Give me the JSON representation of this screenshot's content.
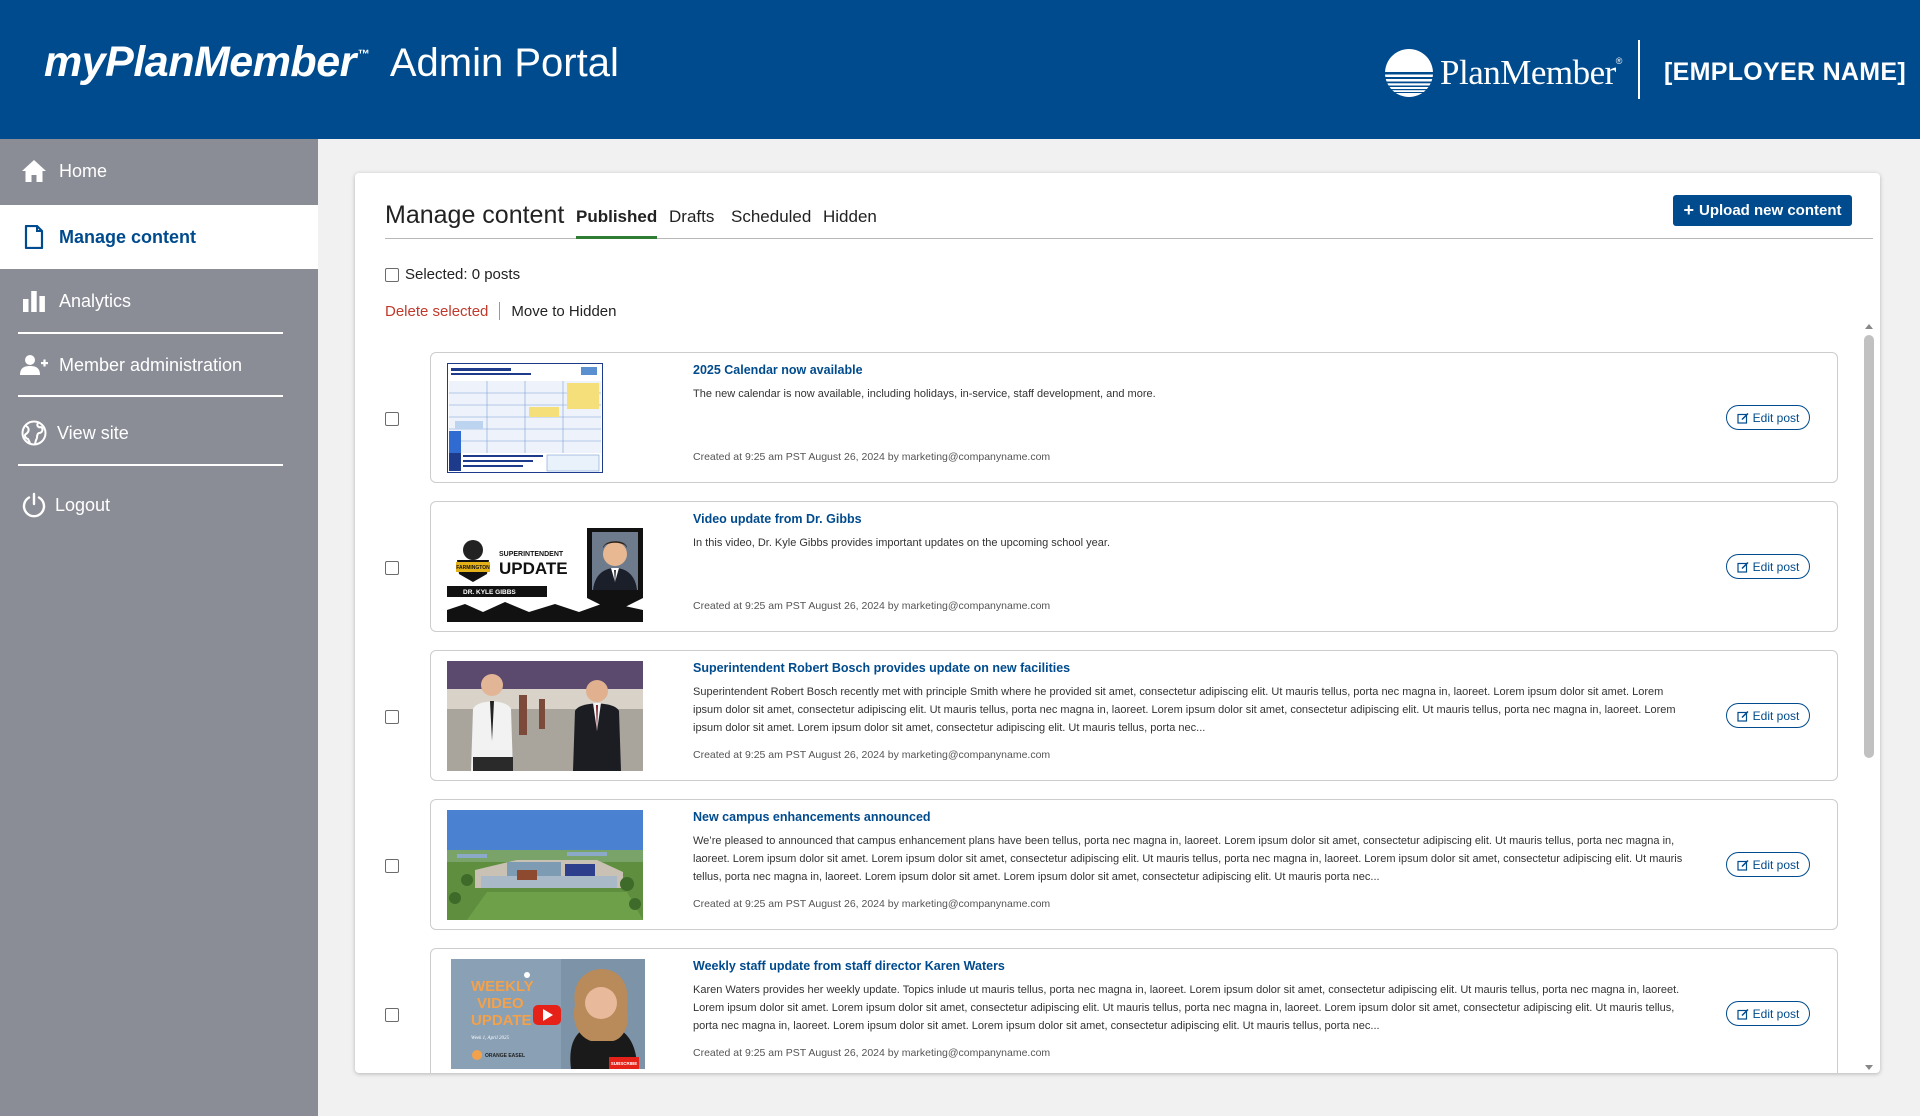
{
  "header": {
    "brand_name": "myPlanMember",
    "brand_tm": "™",
    "brand_sub": "Admin Portal",
    "logo_text": "PlanMember",
    "logo_reg": "®",
    "employer": "[EMPLOYER NAME]",
    "bg_color": "#004b8d"
  },
  "sidebar": {
    "items": [
      {
        "label": "Home",
        "icon": "home-icon"
      },
      {
        "label": "Manage content",
        "icon": "document-icon",
        "active": true
      },
      {
        "label": "Analytics",
        "icon": "bar-chart-icon"
      },
      {
        "label": "Member administration",
        "icon": "add-user-icon"
      },
      {
        "label": "View site",
        "icon": "globe-icon"
      },
      {
        "label": "Logout",
        "icon": "power-icon"
      }
    ]
  },
  "main": {
    "title": "Manage content",
    "tabs": [
      "Published",
      "Drafts",
      "Scheduled",
      "Hidden"
    ],
    "active_tab": "Published",
    "upload_label": "Upload new content",
    "selected_label": "Selected: 0 posts",
    "delete_label": "Delete selected",
    "move_label": "Move to Hidden",
    "edit_label": "Edit post",
    "posts": [
      {
        "title": "2025 Calendar now available",
        "desc": "The new calendar is now available, including holidays, in-service, staff development, and more.",
        "meta": "Created at 9:25 am PST August 26, 2024 by marketing@companyname.com"
      },
      {
        "title": "Video update from Dr. Gibbs",
        "desc": "In this video, Dr. Kyle Gibbs provides important updates on the upcoming school year.",
        "meta": "Created at 9:25 am PST August 26, 2024 by marketing@companyname.com",
        "thumb_text": {
          "super": "SUPERINTENDENT",
          "update": "UPDATE",
          "name": "DR. KYLE GIBBS",
          "badge": "FARMINGTON"
        }
      },
      {
        "title": "Superintendent Robert Bosch provides update on new facilities",
        "desc": "Superintendent Robert Bosch recently met with principle Smith where he provided sit amet, consectetur adipiscing elit. Ut mauris tellus, porta nec magna in, laoreet. Lorem ipsum dolor sit amet. Lorem ipsum dolor sit amet, consectetur adipiscing elit. Ut mauris tellus, porta nec magna in, laoreet. Lorem ipsum dolor sit amet, consectetur adipiscing elit. Ut mauris tellus, porta nec magna in, laoreet. Lorem ipsum dolor sit amet. Lorem ipsum dolor sit amet, consectetur adipiscing elit. Ut mauris tellus, porta nec...",
        "meta": "Created at 9:25 am PST August 26, 2024 by marketing@companyname.com"
      },
      {
        "title": "New campus enhancements announced",
        "desc": "We’re pleased to announced that campus enhancement plans have been tellus, porta nec magna in, laoreet. Lorem ipsum dolor sit amet, consectetur adipiscing elit. Ut mauris tellus, porta nec magna in, laoreet. Lorem ipsum dolor sit amet. Lorem ipsum dolor sit amet, consectetur adipiscing elit. Ut mauris tellus, porta nec magna in, laoreet. Lorem ipsum dolor sit amet, consectetur adipiscing elit. Ut mauris tellus, porta nec magna in, laoreet. Lorem ipsum dolor sit amet. Lorem ipsum dolor sit amet, consectetur adipiscing elit. Ut mauris  porta nec...",
        "meta": "Created at 9:25 am PST August 26, 2024 by marketing@companyname.com"
      },
      {
        "title": "Weekly staff update from staff director Karen Waters",
        "desc": "Karen Waters provides her weekly update. Topics inlude ut mauris tellus, porta nec magna in, laoreet. Lorem ipsum dolor sit amet, consectetur adipiscing elit. Ut mauris tellus, porta nec magna in, laoreet. Lorem ipsum dolor sit amet. Lorem ipsum dolor sit amet, consectetur adipiscing elit. Ut mauris tellus, porta nec magna in, laoreet. Lorem ipsum dolor sit amet, consectetur adipiscing elit. Ut mauris tellus, porta nec magna in, laoreet. Lorem ipsum dolor sit amet. Lorem ipsum dolor sit amet, consectetur adipiscing elit. Ut mauris tellus, porta nec...",
        "meta": "Created at 9:25 am PST August 26, 2024 by marketing@companyname.com",
        "thumb_text": {
          "weekly": "WEEKLY",
          "video": "VIDEO",
          "update": "UPDATE",
          "week": "Week 1, April 2025",
          "brand": "ORANGE EASEL",
          "tag": "SUBSCRIBE"
        }
      }
    ]
  }
}
